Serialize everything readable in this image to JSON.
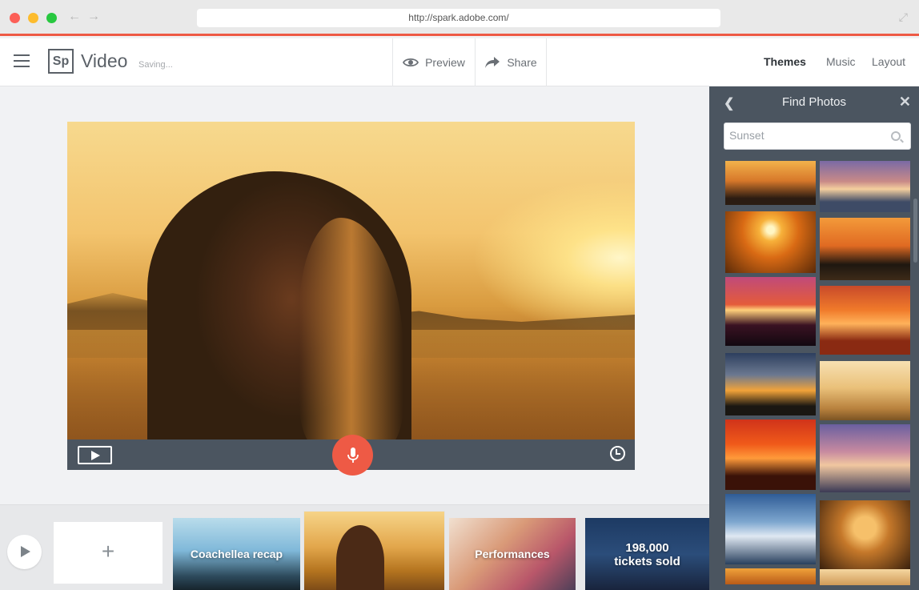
{
  "browser": {
    "url": "http://spark.adobe.com/"
  },
  "header": {
    "logo": "Sp",
    "app_title": "Video",
    "status": "Saving...",
    "preview_label": "Preview",
    "share_label": "Share",
    "links": [
      "Themes",
      "Music",
      "Layout"
    ],
    "active_link": "Themes"
  },
  "panel": {
    "title": "Find Photos",
    "search_value": "Sunset",
    "search_placeholder": "Search"
  },
  "timeline": {
    "add_label": "+",
    "slides": [
      {
        "text": "Coachellea recap"
      },
      {
        "text": ""
      },
      {
        "text": "Performances"
      },
      {
        "line1": "198,000",
        "line2": "tickets sold"
      }
    ]
  },
  "colors": {
    "accent": "#ee5a45",
    "panel_bg": "#4b5560"
  },
  "photo_thumbnails": [
    {
      "name": "fern-sunset-thumb",
      "bg": "linear-gradient(180deg,#f2b24b 0%,#d7782a 45%,#2b1c12 85%)"
    },
    {
      "name": "pier-sunset-thumb",
      "bg": "linear-gradient(180deg,#7b6aa5 0%,#c88a88 40%,#f4cf9e 55%,#3e4b66 80%)"
    },
    {
      "name": "sun-over-clouds-thumb",
      "bg": "radial-gradient(circle at 50% 30%,#fff6c4 0 6%,#f7b13a 18%,#d96a14 45%,#5a2a08 100%)"
    },
    {
      "name": "orange-water-thumb",
      "bg": "linear-gradient(180deg,#f39a3a 0%,#e06a22 45%,#1e1710 75%,#3d2a18 100%)"
    },
    {
      "name": "pink-lake-sunset-thumb",
      "bg": "linear-gradient(180deg,#c04a7a 0%,#e45b3a 40%,#ffcf7a 48%,#3a1222 70%,#120810 100%)"
    },
    {
      "name": "red-clouds-thumb",
      "bg": "linear-gradient(180deg,#c84a2a 0%,#f07a2a 35%,#ffb25a 55%,#8a2a12 80%)"
    },
    {
      "name": "dusk-clouds-thumb",
      "bg": "linear-gradient(180deg,#2d3f5e 0%,#6b7890 35%,#f2a33a 60%,#1a1712 85%)"
    },
    {
      "name": "girl-field-thumb",
      "bg": "linear-gradient(180deg,#f7e0b2 0%,#eac17a 45%,#b9823e 80%,#7c5424 100%)"
    },
    {
      "name": "red-sky-trees-thumb",
      "bg": "linear-gradient(180deg,#d0331a 0%,#f05a1a 35%,#ff9a3a 55%,#3a1208 80%)"
    },
    {
      "name": "purple-sky-thumb",
      "bg": "linear-gradient(180deg,#6a5fa0 0%,#c78aa0 40%,#f1c7a0 60%,#3b3a55 100%)"
    },
    {
      "name": "blue-clouds-thumb",
      "bg": "linear-gradient(180deg,#2f5c96 0%,#7ea7cf 40%,#dfe8f2 60%,#29405e 100%)"
    },
    {
      "name": "ring-silhouette-thumb",
      "bg": "radial-gradient(circle at 50% 40%,#f6c06a 0 18%,#c5782a 40%,#3a200c 100%)"
    },
    {
      "name": "sunset-strip-thumb-1",
      "bg": "linear-gradient(180deg,#f0a23a,#b85a18)"
    },
    {
      "name": "sunset-strip-thumb-2",
      "bg": "linear-gradient(180deg,#f5d6a0,#d09a58)"
    }
  ]
}
